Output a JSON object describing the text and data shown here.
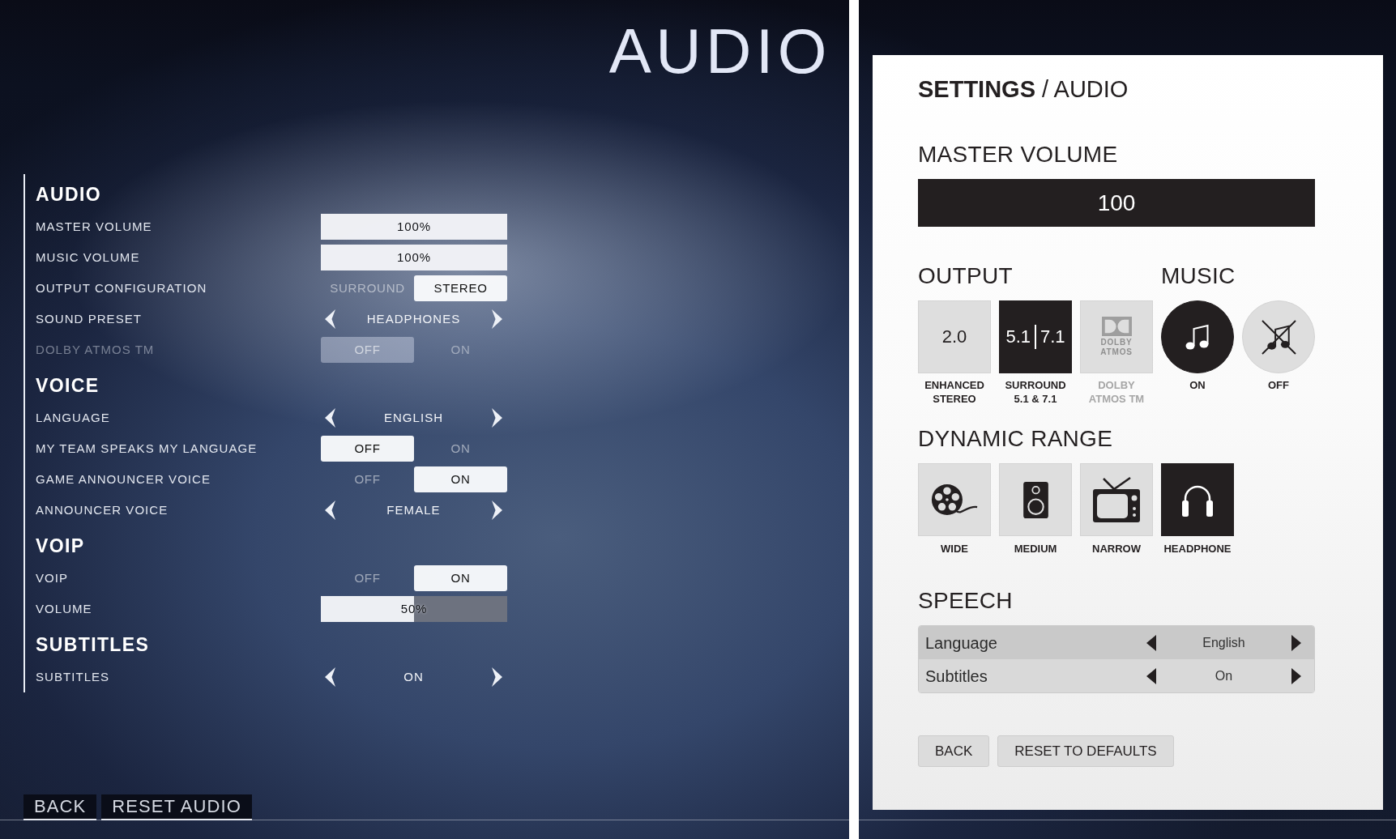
{
  "game_menu": {
    "title": "AUDIO",
    "sections": [
      {
        "heading": "AUDIO",
        "rows": [
          {
            "kind": "slider",
            "label": "MASTER VOLUME",
            "disabled": false,
            "level": 1,
            "reading": "100%"
          },
          {
            "kind": "slider",
            "label": "MUSIC VOLUME",
            "disabled": false,
            "level": 1,
            "reading": "100%"
          },
          {
            "kind": "toggle",
            "label": "OUTPUT CONFIGURATION",
            "disabled": false,
            "options": [
              {
                "label": "SURROUND",
                "selected": false
              },
              {
                "label": "STEREO",
                "selected": true
              }
            ]
          },
          {
            "kind": "selector",
            "label": "SOUND PRESET",
            "disabled": false,
            "value": "HEADPHONES"
          },
          {
            "kind": "toggle",
            "label": "DOLBY ATMOS TM",
            "disabled": true,
            "options": [
              {
                "label": "OFF",
                "selected": true
              },
              {
                "label": "ON",
                "selected": false
              }
            ]
          }
        ]
      },
      {
        "heading": "VOICE",
        "rows": [
          {
            "kind": "selector",
            "label": "LANGUAGE",
            "disabled": false,
            "value": "ENGLISH"
          },
          {
            "kind": "toggle",
            "label": "MY TEAM SPEAKS MY LANGUAGE",
            "disabled": false,
            "options": [
              {
                "label": "OFF",
                "selected": true
              },
              {
                "label": "ON",
                "selected": false
              }
            ]
          },
          {
            "kind": "toggle",
            "label": "GAME ANNOUNCER VOICE",
            "disabled": false,
            "options": [
              {
                "label": "OFF",
                "selected": false
              },
              {
                "label": "ON",
                "selected": true
              }
            ]
          },
          {
            "kind": "selector",
            "label": "ANNOUNCER VOICE",
            "disabled": false,
            "value": "FEMALE"
          }
        ]
      },
      {
        "heading": "VOIP",
        "rows": [
          {
            "kind": "toggle",
            "label": "VOIP",
            "disabled": false,
            "options": [
              {
                "label": "OFF",
                "selected": false
              },
              {
                "label": "ON",
                "selected": true
              }
            ]
          },
          {
            "kind": "slider",
            "label": "VOLUME",
            "disabled": false,
            "level": 0.5,
            "reading": "50%"
          }
        ]
      },
      {
        "heading": "SUBTITLES",
        "rows": [
          {
            "kind": "selector",
            "label": "SUBTITLES",
            "disabled": false,
            "value": "ON"
          }
        ]
      }
    ],
    "buttons": [
      {
        "label": "BACK"
      },
      {
        "label": "RESET AUDIO"
      }
    ]
  },
  "redesign_panel": {
    "breadcrumb": "**SETTINGS** / AUDIO",
    "master_volume": {
      "heading": "MASTER VOLUME",
      "level": 1,
      "value": "100"
    },
    "output": {
      "heading": "OUTPUT",
      "options": [
        {
          "kind": "text",
          "tile_text": [
            "2.0"
          ],
          "caption": "ENHANCED\nSTEREO",
          "selected": false,
          "disabled": false
        },
        {
          "kind": "split",
          "tile_text": [
            "5.1",
            "7.1"
          ],
          "caption": "SURROUND\n5.1 & 7.1",
          "selected": true,
          "disabled": false
        },
        {
          "kind": "logo",
          "tile_text": [
            "DOLBY",
            "ATMOS"
          ],
          "caption": "DOLBY\nATMOS TM",
          "selected": false,
          "disabled": true
        }
      ]
    },
    "music": {
      "heading": "MUSIC",
      "options": [
        {
          "kind": "note",
          "caption": "ON",
          "selected": true
        },
        {
          "kind": "muted-note",
          "caption": "OFF",
          "selected": false
        }
      ]
    },
    "dynamic_range": {
      "heading": "DYNAMIC RANGE",
      "options": [
        {
          "kind": "film",
          "caption": "WIDE",
          "selected": false
        },
        {
          "kind": "speaker",
          "caption": "MEDIUM",
          "selected": false
        },
        {
          "kind": "tv",
          "caption": "NARROW",
          "selected": false
        },
        {
          "kind": "headphones",
          "caption": "HEADPHONE",
          "selected": true
        }
      ]
    },
    "speech": {
      "heading": "SPEECH",
      "rows": [
        {
          "label": "Language",
          "value": "English",
          "selected": true
        },
        {
          "label": "Subtitles",
          "value": "On",
          "selected": false
        }
      ]
    },
    "buttons": [
      {
        "label": "BACK"
      },
      {
        "label": "RESET TO DEFAULTS"
      }
    ]
  }
}
